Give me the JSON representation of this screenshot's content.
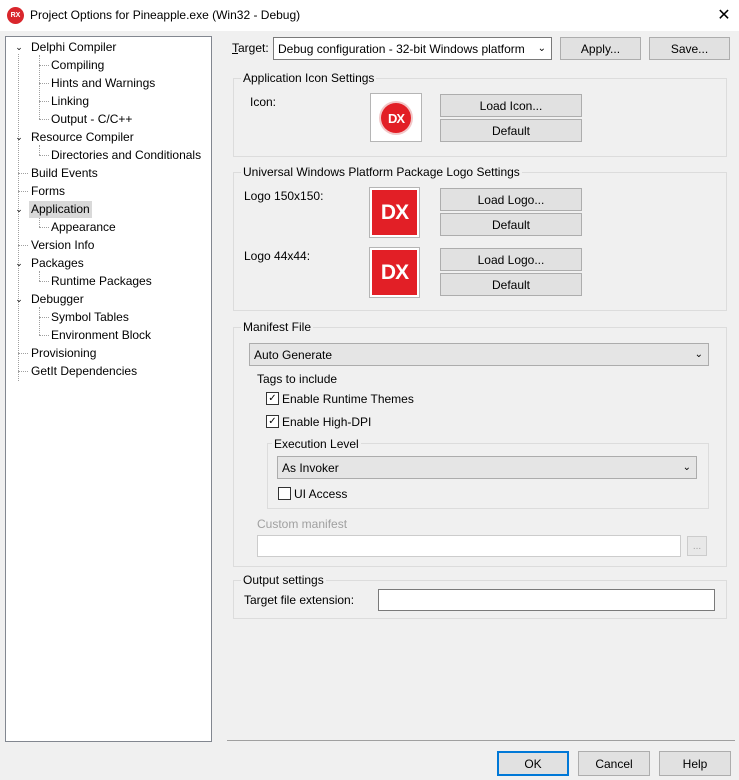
{
  "window": {
    "title": "Project Options for Pineapple.exe  (Win32 - Debug)",
    "app_icon_text": "RX",
    "close_glyph": "✕"
  },
  "tree": {
    "items": [
      {
        "label": "Delphi Compiler",
        "expanded": true
      },
      {
        "label": "Compiling"
      },
      {
        "label": "Hints and Warnings"
      },
      {
        "label": "Linking"
      },
      {
        "label": "Output - C/C++"
      },
      {
        "label": "Resource Compiler",
        "expanded": true
      },
      {
        "label": "Directories and Conditionals"
      },
      {
        "label": "Build Events"
      },
      {
        "label": "Forms"
      },
      {
        "label": "Application",
        "expanded": true,
        "selected": true
      },
      {
        "label": "Appearance"
      },
      {
        "label": "Version Info"
      },
      {
        "label": "Packages",
        "expanded": true
      },
      {
        "label": "Runtime Packages"
      },
      {
        "label": "Debugger",
        "expanded": true
      },
      {
        "label": "Symbol Tables"
      },
      {
        "label": "Environment Block"
      },
      {
        "label": "Provisioning"
      },
      {
        "label": "GetIt Dependencies"
      }
    ]
  },
  "target": {
    "label_prefix": "T",
    "label_rest": "arget:",
    "value": "Debug configuration - 32-bit Windows platform",
    "apply": "Apply...",
    "save": "Save..."
  },
  "icon_settings": {
    "title": "Application Icon Settings",
    "icon_label": "Icon:",
    "load_icon": "Load Icon...",
    "default": "Default",
    "icon_text": "DX"
  },
  "uwp": {
    "title": "Universal Windows Platform Package Logo Settings",
    "logo150_label": "Logo 150x150:",
    "logo44_label": "Logo 44x44:",
    "load_logo": "Load Logo...",
    "default": "Default",
    "logo_text": "DX"
  },
  "manifest": {
    "title": "Manifest File",
    "mode": "Auto Generate",
    "tags_label": "Tags to include",
    "enable_themes": "Enable Runtime Themes",
    "enable_themes_checked": true,
    "enable_dpi": "Enable High-DPI",
    "enable_dpi_checked": true,
    "exec_level_title": "Execution Level",
    "exec_level": "As Invoker",
    "ui_access": "UI Access",
    "ui_access_checked": false,
    "custom_label": "Custom manifest",
    "custom_value": "",
    "browse": "..."
  },
  "output": {
    "title": "Output settings",
    "ext_label": "Target file extension:",
    "ext_value": ""
  },
  "footer": {
    "ok": "OK",
    "cancel": "Cancel",
    "help": "Help"
  },
  "colors": {
    "brand_red": "#e21f26",
    "selection": "#d9d9d9",
    "default_button_border": "#0078d7"
  }
}
